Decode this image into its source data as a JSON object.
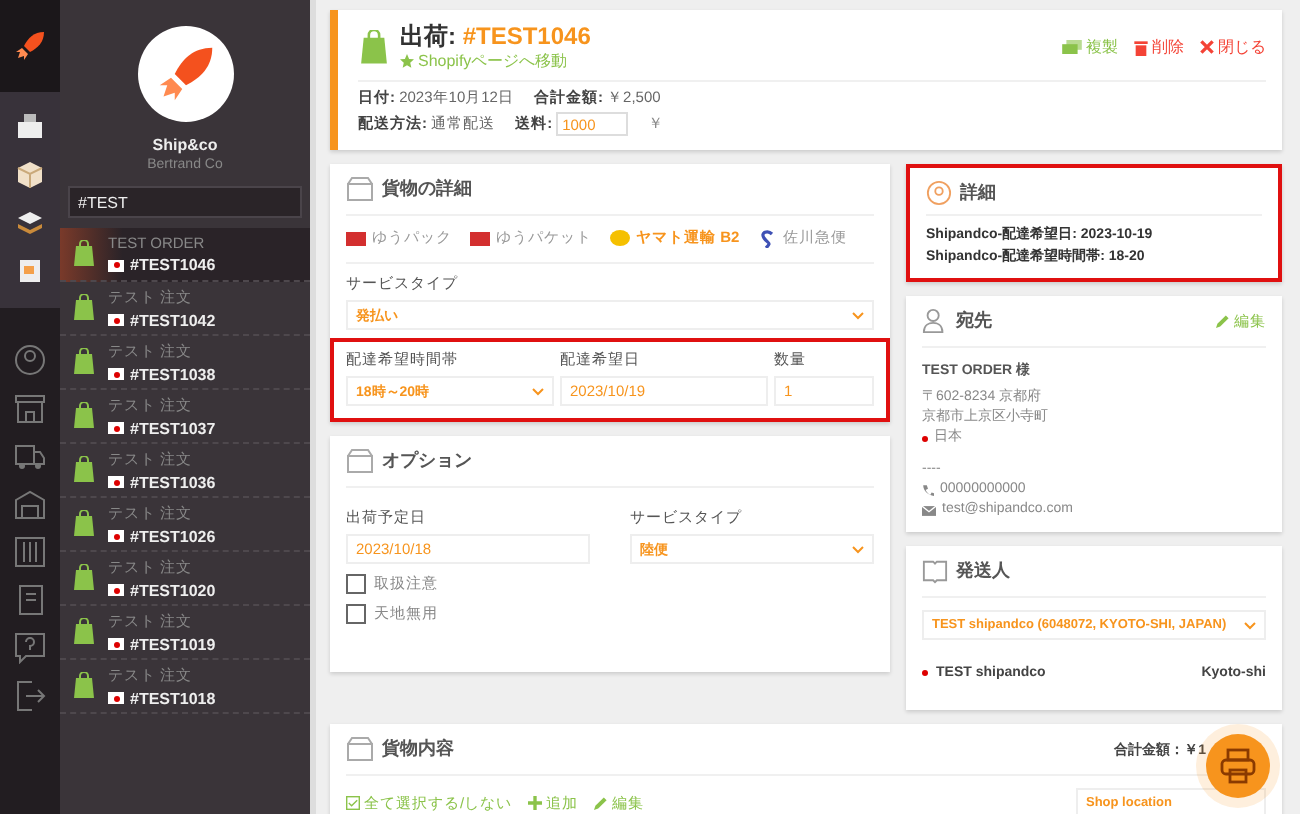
{
  "profile": {
    "name": "Ship&co",
    "company": "Bertrand Co"
  },
  "search": {
    "value": "#TEST"
  },
  "orders": [
    {
      "title": "TEST ORDER",
      "number": "#TEST1046",
      "selected": true
    },
    {
      "title": "テスト 注文",
      "number": "#TEST1042",
      "selected": false
    },
    {
      "title": "テスト 注文",
      "number": "#TEST1038",
      "selected": false
    },
    {
      "title": "テスト 注文",
      "number": "#TEST1037",
      "selected": false
    },
    {
      "title": "テスト 注文",
      "number": "#TEST1036",
      "selected": false
    },
    {
      "title": "テスト 注文",
      "number": "#TEST1026",
      "selected": false
    },
    {
      "title": "テスト 注文",
      "number": "#TEST1020",
      "selected": false
    },
    {
      "title": "テスト 注文",
      "number": "#TEST1019",
      "selected": false
    },
    {
      "title": "テスト 注文",
      "number": "#TEST1018",
      "selected": false
    }
  ],
  "header": {
    "title_label": "出荷:",
    "order_number": "#TEST1046",
    "shopify_link": "Shopifyページへ移動",
    "actions": [
      {
        "kind": "copy",
        "label": "複製"
      },
      {
        "kind": "delete",
        "label": "削除"
      },
      {
        "kind": "close",
        "label": "閉じる"
      }
    ],
    "date_label": "日付:",
    "date": "2023年10月12日",
    "total_label": "合計金額:",
    "total": "￥2,500",
    "method_label": "配送方法:",
    "method": "通常配送",
    "fee_label": "送料:",
    "fee": "1000",
    "fee_unit": "￥"
  },
  "cargo": {
    "title": "貨物の詳細",
    "carriers": [
      {
        "kind": "jp",
        "label": "ゆうパック",
        "selected": false
      },
      {
        "kind": "jp",
        "label": "ゆうパケット",
        "selected": false
      },
      {
        "kind": "yamato",
        "label": "ヤマト運輸 B2",
        "selected": true
      },
      {
        "kind": "sagawa",
        "label": "佐川急便",
        "selected": false
      }
    ],
    "service_label": "サービスタイプ",
    "service": "発払い",
    "highlighted": true,
    "time_label": "配達希望時間帯",
    "time": "18時～20時",
    "date_label": "配達希望日",
    "date": "2023/10/19",
    "qty_label": "数量",
    "qty": "1"
  },
  "options": {
    "title": "オプション",
    "ship_date_label": "出荷予定日",
    "ship_date": "2023/10/18",
    "service_label": "サービスタイプ",
    "service": "陸便",
    "checks": [
      {
        "label": "取扱注意",
        "checked": false
      },
      {
        "label": "天地無用",
        "checked": false
      }
    ]
  },
  "details": {
    "title": "詳細",
    "highlighted": true,
    "lines": [
      "Shipandco-配達希望日: 2023-10-19",
      "Shipandco-配達希望時間帯: 18-20"
    ]
  },
  "recipient": {
    "title": "宛先",
    "edit": "編集",
    "name": "TEST ORDER 様",
    "address": [
      "〒602-8234 京都府",
      "京都市上京区小寺町"
    ],
    "country": "日本",
    "company": "----",
    "phone": "00000000000",
    "email": "test@shipandco.com"
  },
  "sender": {
    "title": "発送人",
    "select": "TEST shipandco (6048072, KYOTO-SHI, JAPAN)",
    "name": "TEST shipandco",
    "city": "Kyoto-shi"
  },
  "contents": {
    "title": "貨物内容",
    "total": "合計金額：￥1",
    "select_all": "全て選択する/しない",
    "add": "追加",
    "edit": "編集",
    "location": "Shop location"
  }
}
